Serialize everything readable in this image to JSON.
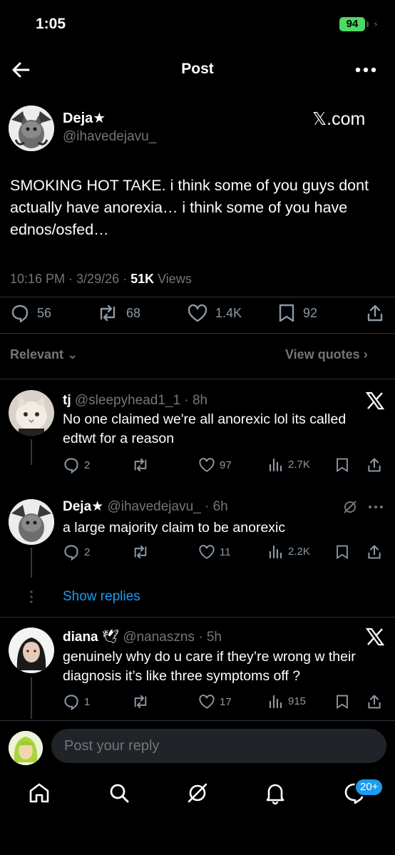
{
  "status_bar": {
    "time": "1:05",
    "battery": "94",
    "charging_symbol": "⚡"
  },
  "header": {
    "title": "Post",
    "back_icon": "back-arrow-icon",
    "more_icon": "more-horizontal-icon"
  },
  "post": {
    "author_name": "Deja★",
    "author_handle": "@ihavedejavu_",
    "source_badge": "𝕏.com",
    "text": "SMOKING HOT TAKE. i think some of you guys dont actually have anorexia… i think some of you have ednos/osfed…",
    "time": "10:16 PM · 3/29/26 · ",
    "views_count": "51K",
    "views_label": " Views",
    "replies": "56",
    "reposts": "68",
    "likes": "1.4K",
    "bookmarks": "92"
  },
  "filter": {
    "sort_label": "Relevant",
    "view_quotes": "View quotes"
  },
  "replies": [
    {
      "name": "tj",
      "handle": "@sleepyhead1_1 · 8h",
      "text": "No one claimed we're all anorexic lol its called edtwt for a reason",
      "replies": "2",
      "reposts": "",
      "likes": "97",
      "views": "2.7K"
    },
    {
      "name": "Deja★",
      "handle": "@ihavedejavu_ · 6h",
      "text": "a large majority claim to be anorexic",
      "replies": "2",
      "reposts": "",
      "likes": "11",
      "views": "2.2K"
    },
    {
      "name": "diana",
      "name_emoji": "🕊",
      "handle": "@nanaszns · 5h",
      "text": "genuinely why do u care if they’re wrong w their diagnosis it’s like three symptoms off ?",
      "replies": "1",
      "reposts": "",
      "likes": "17",
      "views": "915"
    }
  ],
  "show_replies": "Show replies",
  "compose": {
    "placeholder": "Post your reply"
  },
  "bottom_nav": {
    "items": [
      "home-icon",
      "search-icon",
      "grok-icon",
      "notifications-icon",
      "messages-icon"
    ],
    "messages_badge": "20+"
  },
  "colors": {
    "accent": "#1d9bf0",
    "background": "#000000",
    "muted": "#71767b",
    "battery": "#4cd964"
  }
}
